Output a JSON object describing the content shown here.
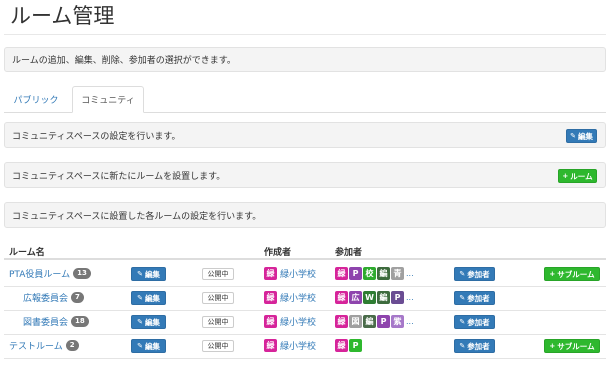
{
  "page": {
    "title": "ルーム管理",
    "description": "ルームの追加、編集、削除、参加者の選択ができます。"
  },
  "tabs": [
    {
      "label": "パブリック",
      "active": false
    },
    {
      "label": "コミュニティ",
      "active": true
    }
  ],
  "sections": {
    "settings_text": "コミュニティスペースの設定を行います。",
    "edit_label": "編集",
    "new_room_text": "コミュニティスペースに新たにルームを設置します。",
    "add_room_label": "ルーム",
    "rooms_text": "コミュニティスペースに設置した各ルームの設定を行います。"
  },
  "table": {
    "headers": {
      "name": "ルーム名",
      "creator": "作成者",
      "participants": "参加者"
    },
    "edit_label": "編集",
    "status_label": "公開中",
    "participants_label": "参加者",
    "subroom_label": "サブルーム",
    "ellipsis": "...",
    "rows": [
      {
        "name": "PTA役員ルーム",
        "count": "13",
        "creator_chip": "緑",
        "creator": "緑小学校",
        "participants": [
          {
            "t": "緑",
            "c": "#d6249a"
          },
          {
            "t": "P",
            "c": "#8e44ad"
          },
          {
            "t": "校",
            "c": "#2eaa2e"
          },
          {
            "t": "編",
            "c": "#3d6b3d"
          },
          {
            "t": "青",
            "c": "#a0a0a0"
          }
        ],
        "has_subroom": true,
        "indent": false
      },
      {
        "name": "広報委員会",
        "count": "7",
        "creator_chip": "緑",
        "creator": "緑小学校",
        "participants": [
          {
            "t": "緑",
            "c": "#d6249a"
          },
          {
            "t": "広",
            "c": "#8e44ad"
          },
          {
            "t": "W",
            "c": "#2e7d32"
          },
          {
            "t": "編",
            "c": "#3d6b3d"
          },
          {
            "t": "P",
            "c": "#6a4c93"
          }
        ],
        "has_subroom": false,
        "indent": true
      },
      {
        "name": "図書委員会",
        "count": "18",
        "creator_chip": "緑",
        "creator": "緑小学校",
        "participants": [
          {
            "t": "緑",
            "c": "#d6249a"
          },
          {
            "t": "図",
            "c": "#a0a0a0"
          },
          {
            "t": "編",
            "c": "#4a6b4a"
          },
          {
            "t": "P",
            "c": "#8e44ad"
          },
          {
            "t": "紫",
            "c": "#a678c9"
          }
        ],
        "has_subroom": false,
        "indent": true
      },
      {
        "name": "テストルーム",
        "count": "2",
        "creator_chip": "緑",
        "creator": "緑小学校",
        "participants": [
          {
            "t": "緑",
            "c": "#d6249a"
          },
          {
            "t": "P",
            "c": "#2eb82e"
          }
        ],
        "has_subroom": true,
        "indent": false
      }
    ]
  },
  "colors": {
    "creator_chip": "#d6249a",
    "primary": "#337ab7",
    "success": "#2eb82e"
  }
}
